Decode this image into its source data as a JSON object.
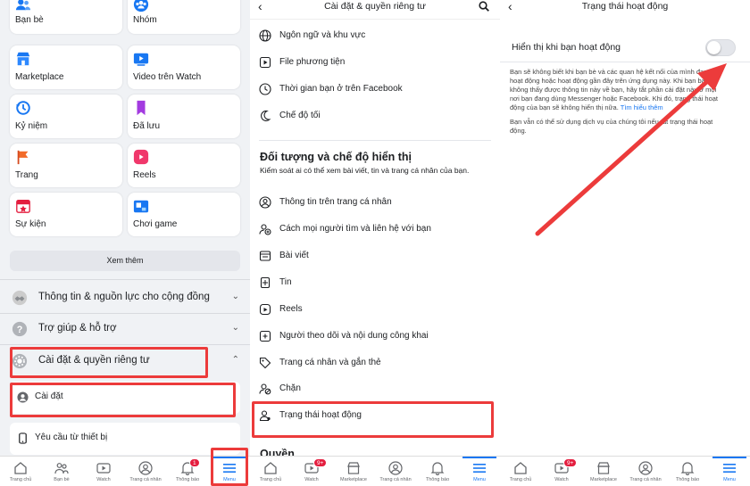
{
  "menu": {
    "shortcuts": [
      {
        "label": "Bạn bè",
        "icon": "friends-icon"
      },
      {
        "label": "Nhóm",
        "icon": "groups-icon"
      },
      {
        "label": "Marketplace",
        "icon": "marketplace-icon"
      },
      {
        "label": "Video trên Watch",
        "icon": "watch-video-icon"
      },
      {
        "label": "Kỷ niệm",
        "icon": "memories-icon"
      },
      {
        "label": "Đã lưu",
        "icon": "saved-icon"
      },
      {
        "label": "Trang",
        "icon": "pages-flag-icon"
      },
      {
        "label": "Reels",
        "icon": "reels-icon"
      },
      {
        "label": "Sự kiện",
        "icon": "events-icon"
      },
      {
        "label": "Chơi game",
        "icon": "gaming-icon"
      }
    ],
    "see_more": "Xem thêm",
    "sections": [
      {
        "label": "Thông tin & nguồn lực cho cộng đồng"
      },
      {
        "label": "Trợ giúp & hỗ trợ"
      },
      {
        "label": "Cài đặt & quyền riêng tư"
      }
    ],
    "sub_items": [
      {
        "label": "Cài đặt"
      },
      {
        "label": "Yêu cầu từ thiết bị"
      }
    ]
  },
  "tabbar_menu": {
    "tabs": [
      "Trang chủ",
      "Bạn bè",
      "Watch",
      "Trang cá nhân",
      "Thông báo",
      "Menu"
    ],
    "notif_badge": "1"
  },
  "settings": {
    "title": "Cài đặt & quyền riêng tư",
    "top_items": [
      "Ngôn ngữ và khu vực",
      "File phương tiện",
      "Thời gian bạn ở trên Facebook",
      "Chế độ tối"
    ],
    "section_title": "Đối tượng và chế độ hiển thị",
    "section_desc": "Kiểm soát ai có thể xem bài viết, tin và trang cá nhân của bạn.",
    "items": [
      "Thông tin trên trang cá nhân",
      "Cách mọi người tìm và liên hệ với bạn",
      "Bài viết",
      "Tin",
      "Reels",
      "Người theo dõi và nội dung công khai",
      "Trang cá nhân và gắn thẻ",
      "Chặn",
      "Trạng thái hoạt động"
    ],
    "next_section": "Quyền"
  },
  "tabbar_other": {
    "tabs": [
      "Trang chủ",
      "Watch",
      "Marketplace",
      "Trang cá nhân",
      "Thông báo",
      "Menu"
    ],
    "watch_badge": "9+"
  },
  "active_status": {
    "title": "Trạng thái hoạt động",
    "toggle_label": "Hiển thị khi bạn hoạt động",
    "toggle_on": false,
    "para1": "Bạn sẽ không biết khi bạn bè và các quan hệ kết nối của mình đang hoạt động hoặc hoạt động gần đây trên ứng dụng này. Khi bạn bảo họ không thấy được thông tin này về bạn, hãy tắt phần cài đặt này ở mọi nơi bạn đang dùng Messenger hoặc Facebook. Khi đó, trạng thái hoạt động của bạn sẽ không hiển thị nữa.",
    "learn_more": "Tìm hiểu thêm",
    "para2": "Bạn vẫn có thể sử dụng dịch vụ của chúng tôi nếu tắt trạng thái hoạt động."
  },
  "colors": {
    "accent": "#1877f2",
    "highlight": "#ec3b3b"
  }
}
